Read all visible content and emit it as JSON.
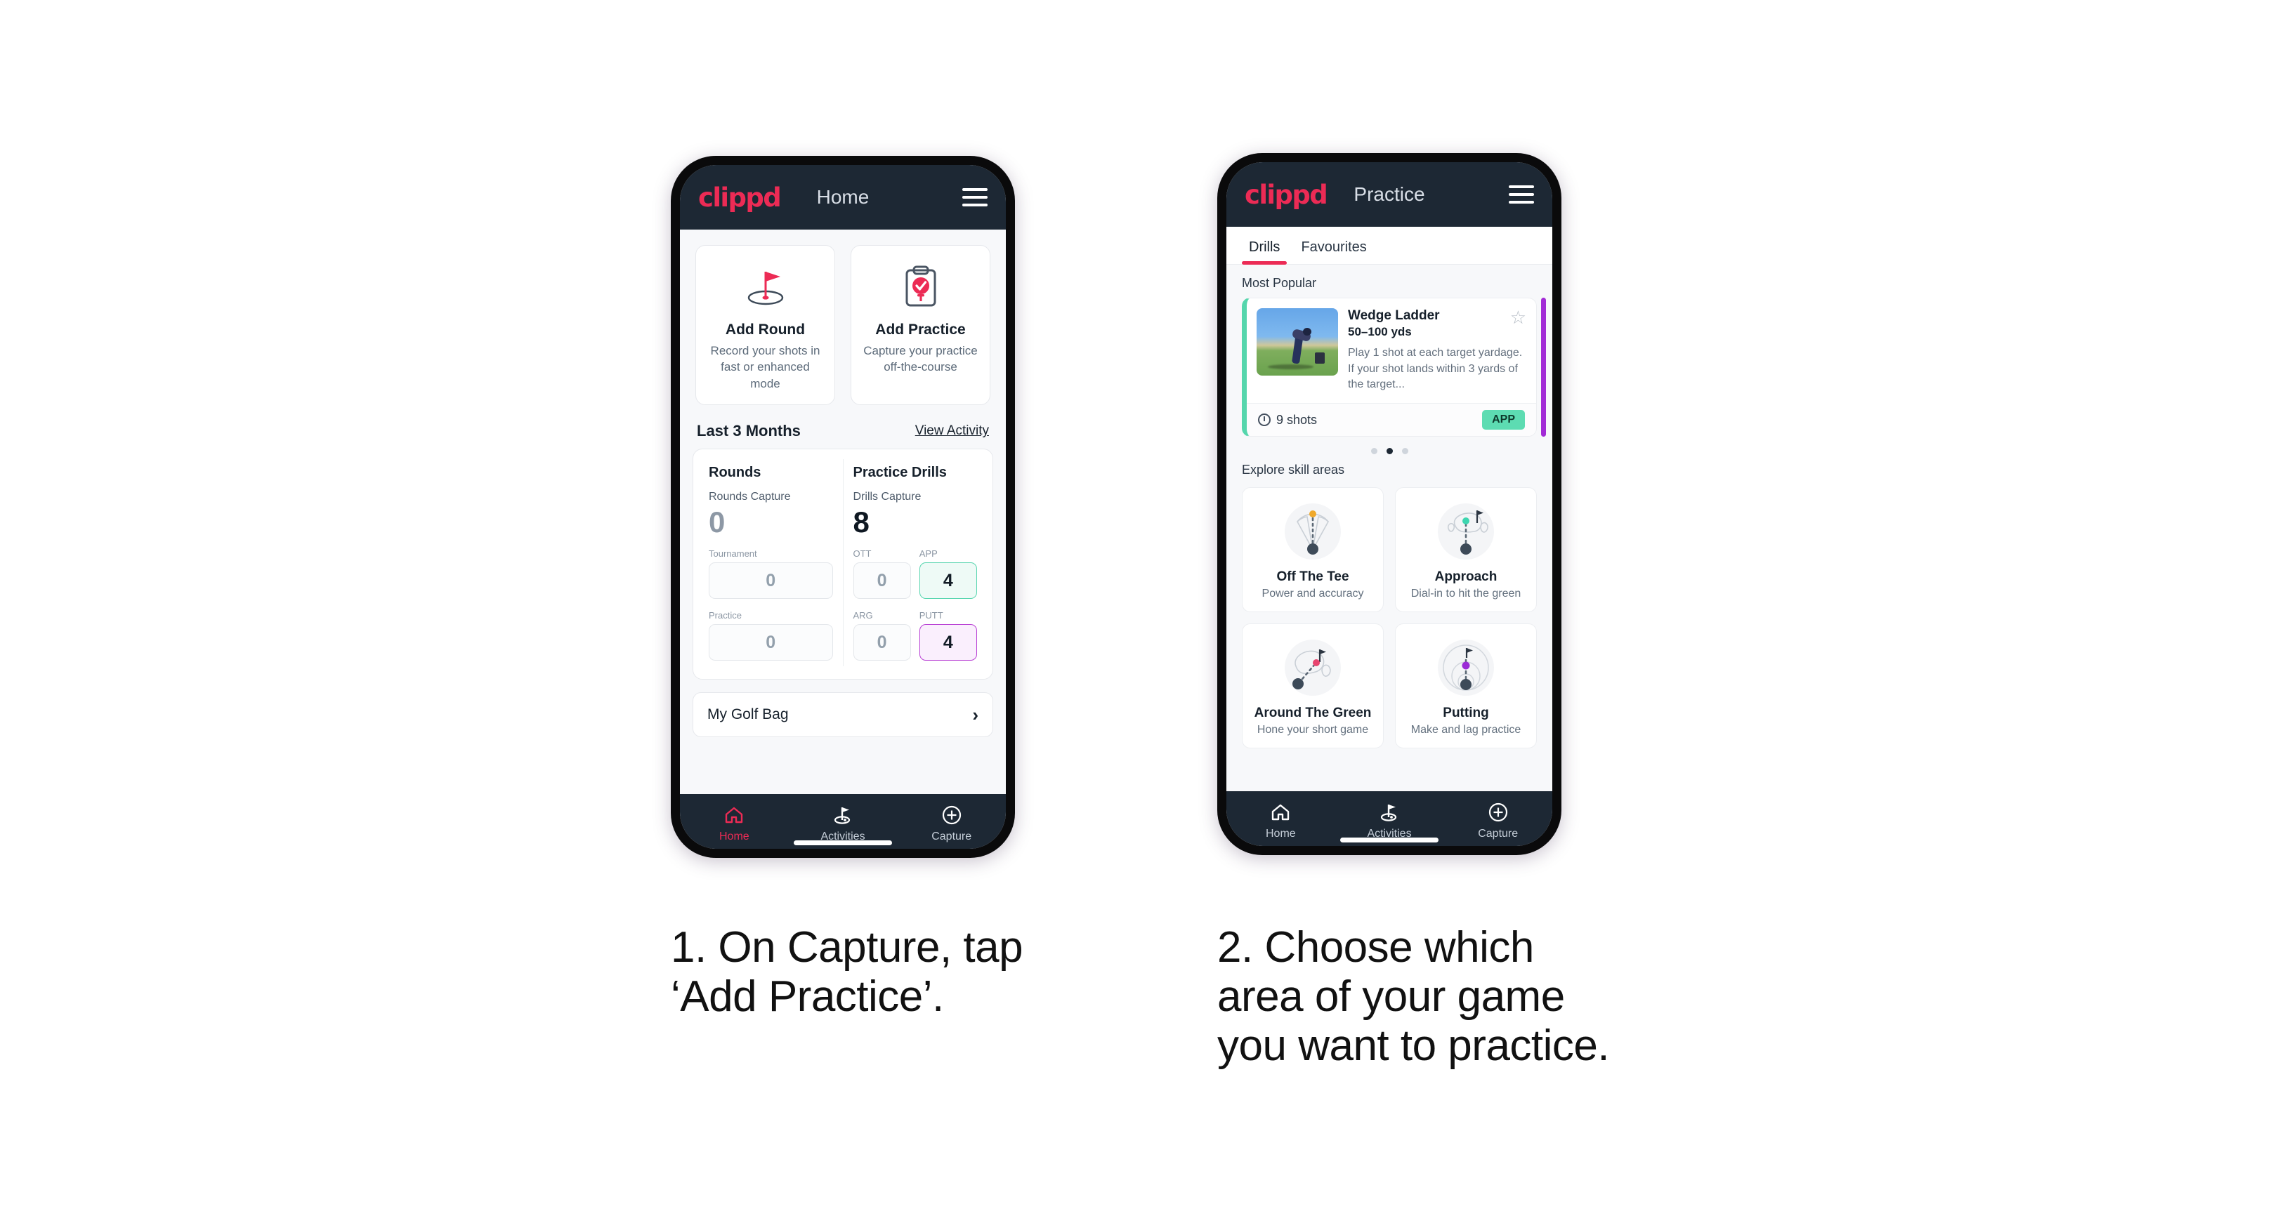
{
  "brand": {
    "logo": "clippd",
    "accent": "#ec2b55",
    "dark": "#1d2834"
  },
  "phone1": {
    "header": {
      "title": "Home",
      "menu_icon": "hamburger-icon"
    },
    "action_cards": [
      {
        "icon": "golf-flag-hole-icon",
        "title": "Add Round",
        "subtitle": "Record your shots in fast or enhanced mode"
      },
      {
        "icon": "clipboard-check-tee-icon",
        "title": "Add Practice",
        "subtitle": "Capture your practice off-the-course"
      }
    ],
    "section": {
      "title": "Last 3 Months",
      "link": "View Activity"
    },
    "stats": {
      "rounds": {
        "heading": "Rounds",
        "capture_label": "Rounds Capture",
        "capture_value": "0",
        "fields": [
          {
            "label": "Tournament",
            "value": "0",
            "state": "empty"
          },
          {
            "label": "Practice",
            "value": "0",
            "state": "empty"
          }
        ]
      },
      "drills": {
        "heading": "Practice Drills",
        "capture_label": "Drills Capture",
        "capture_value": "8",
        "fields": [
          {
            "label": "OTT",
            "value": "0",
            "state": "empty"
          },
          {
            "label": "APP",
            "value": "4",
            "state": "app"
          },
          {
            "label": "ARG",
            "value": "0",
            "state": "empty"
          },
          {
            "label": "PUTT",
            "value": "4",
            "state": "putt"
          }
        ]
      }
    },
    "golf_bag": {
      "label": "My Golf Bag",
      "chevron": "chevron-right-icon"
    },
    "nav": [
      {
        "icon": "home-icon",
        "label": "Home",
        "active": true
      },
      {
        "icon": "golf-flag-icon",
        "label": "Activities",
        "active": false
      },
      {
        "icon": "plus-circle-icon",
        "label": "Capture",
        "active": false
      }
    ]
  },
  "phone2": {
    "header": {
      "title": "Practice",
      "menu_icon": "hamburger-icon"
    },
    "tabs": [
      {
        "label": "Drills",
        "active": true
      },
      {
        "label": "Favourites",
        "active": false
      }
    ],
    "most_popular_label": "Most Popular",
    "drill": {
      "name": "Wedge Ladder",
      "yardage": "50–100 yds",
      "description": "Play 1 shot at each target yardage. If your shot lands within 3 yards of the target...",
      "shots": "9 shots",
      "badge": "APP",
      "badge_color": "#5ddcb2",
      "accent_color": "#55d6ac",
      "star_icon": "star-outline-icon",
      "thumbnail": "golfer-wedge-shot-photo"
    },
    "carousel_dots": {
      "count": 3,
      "active_index": 1
    },
    "explore_label": "Explore skill areas",
    "skill_areas": [
      {
        "icon": "off-the-tee-fan-icon",
        "title": "Off The Tee",
        "subtitle": "Power and accuracy",
        "dot_color": "#f0a92b"
      },
      {
        "icon": "approach-green-icon",
        "title": "Approach",
        "subtitle": "Dial-in to hit the green",
        "dot_color": "#3ed6b0"
      },
      {
        "icon": "around-the-green-icon",
        "title": "Around The Green",
        "subtitle": "Hone your short game",
        "dot_color": "#e8456f"
      },
      {
        "icon": "putting-rings-icon",
        "title": "Putting",
        "subtitle": "Make and lag practice",
        "dot_color": "#9b2bd6"
      }
    ],
    "nav": [
      {
        "icon": "home-icon",
        "label": "Home",
        "active": false
      },
      {
        "icon": "golf-flag-icon",
        "label": "Activities",
        "active": false
      },
      {
        "icon": "plus-circle-icon",
        "label": "Capture",
        "active": false
      }
    ]
  },
  "captions": [
    {
      "line1": "1. On Capture, tap",
      "line2": "‘Add Practice’."
    },
    {
      "line1": "2. Choose which",
      "line2": "area of your game",
      "line3": "you want to practice."
    }
  ]
}
